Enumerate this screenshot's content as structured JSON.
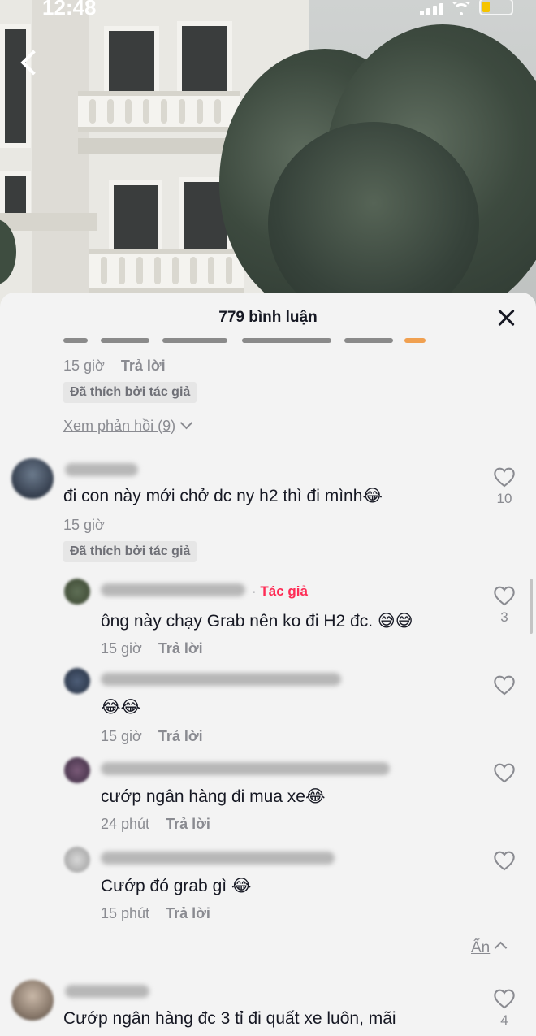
{
  "status": {
    "time": "12:48"
  },
  "sheet": {
    "title": "779 bình luận"
  },
  "comments": [
    {
      "time": "15 giờ",
      "reply_label": "Trả lời",
      "liked_badge": "Đã thích bởi tác giả",
      "view_replies": "Xem phản hồi (9)"
    },
    {
      "text": "đi con này mới chở dc ny h2 thì đi mình😂",
      "time": "15 giờ",
      "likes": "10",
      "liked_badge": "Đã thích bởi tác giả",
      "replies": [
        {
          "author_tag": "Tác giả",
          "text": "ông này chạy Grab nên ko đi H2 đc. 😅😅",
          "time": "15 giờ",
          "reply_label": "Trả lời",
          "likes": "3"
        },
        {
          "text": "😂😂",
          "time": "15 giờ",
          "reply_label": "Trả lời"
        },
        {
          "text": "cướp ngân hàng đi mua xe😂",
          "time": "24 phút",
          "reply_label": "Trả lời"
        },
        {
          "text": "Cướp đó grab gì 😂",
          "time": "15 phút",
          "reply_label": "Trả lời"
        }
      ],
      "hide_label": "Ẩn"
    },
    {
      "text": "Cướp ngân hàng đc 3 tỉ đi quất xe luôn, mãi",
      "likes": "4"
    }
  ],
  "colors": {
    "accent": "#fe2c55",
    "muted": "#8a8b91",
    "text": "#161823",
    "badge_bg": "#e6e6e6"
  },
  "icons": [
    "back-chevron-icon",
    "signal-icon",
    "wifi-icon",
    "battery-icon",
    "close-icon",
    "heart-outline-icon",
    "chevron-down-icon",
    "chevron-up-icon"
  ]
}
